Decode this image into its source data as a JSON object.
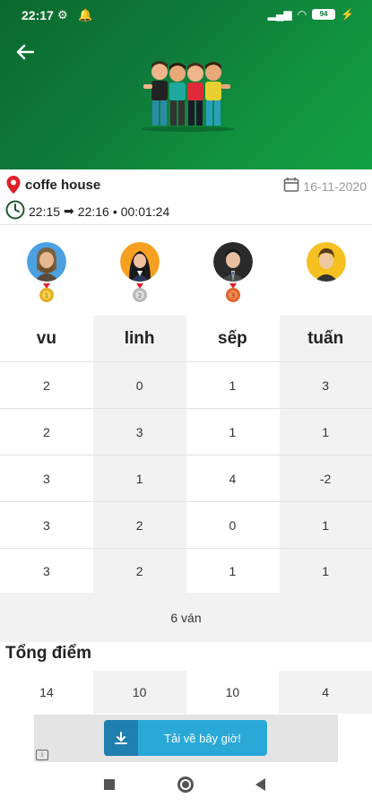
{
  "status": {
    "time": "22:17",
    "battery": "94"
  },
  "location": {
    "name": "coffe house",
    "date": "16-11-2020"
  },
  "session": {
    "start": "22:15",
    "end": "22:16",
    "duration": "00:01:24"
  },
  "players": [
    "vu",
    "linh",
    "sếp",
    "tuấn"
  ],
  "rows": [
    [
      "2",
      "0",
      "1",
      "3"
    ],
    [
      "2",
      "3",
      "1",
      "1"
    ],
    [
      "3",
      "1",
      "4",
      "-2"
    ],
    [
      "3",
      "2",
      "0",
      "1"
    ],
    [
      "3",
      "2",
      "1",
      "1"
    ]
  ],
  "rounds_label": "6 ván",
  "total_title": "Tổng điểm",
  "totals": [
    "14",
    "10",
    "10",
    "4"
  ],
  "ad": {
    "button_label": "Tải về bây giờ!"
  },
  "colors": {
    "header_green": "#10923f",
    "gold": "#e6b020",
    "silver": "#c8c8c8",
    "bronze": "#e0642a",
    "ad_blue": "#2aa9d8"
  }
}
